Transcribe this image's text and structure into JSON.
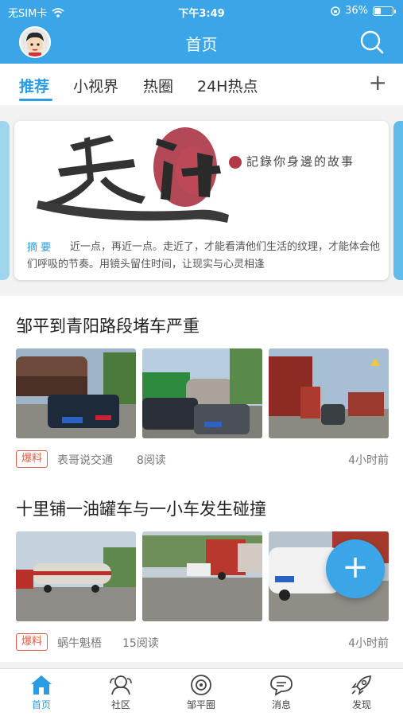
{
  "status_bar": {
    "carrier": "无SIM卡",
    "time": "下午3:49",
    "battery": "36%",
    "battery_level": 0.36
  },
  "header": {
    "title": "首页",
    "avatar_icon": "cartoon-avatar",
    "search_icon": "search-icon"
  },
  "tabs": [
    {
      "label": "推荐",
      "active": true
    },
    {
      "label": "小视界",
      "active": false
    },
    {
      "label": "热圈",
      "active": false
    },
    {
      "label": "24H热点",
      "active": false
    }
  ],
  "add_tab_label": "+",
  "banner": {
    "calligraphy": "走近",
    "slogan": "記錄你身邊的故事",
    "summary_label": "摘 要",
    "summary_text": "近一点，再近一点。走近了，才能看清他们生活的纹理，才能体会他们呼吸的节奏。用镜头留住时间，让现实与心灵相逢"
  },
  "news": [
    {
      "title": "邹平到青阳路段堵车严重",
      "badge": "爆料",
      "author": "表哥说交通",
      "reads": "8阅读",
      "time": "4小时前"
    },
    {
      "title": "十里铺一油罐车与一小车发生碰撞",
      "badge": "爆料",
      "author": "蜗牛魁梧",
      "reads": "15阅读",
      "time": "4小时前"
    }
  ],
  "fab_label": "+",
  "bottom_tabs": [
    {
      "label": "首页",
      "icon": "home-icon",
      "active": true
    },
    {
      "label": "社区",
      "icon": "community-icon",
      "active": false
    },
    {
      "label": "邹平圈",
      "icon": "circle-icon",
      "active": false
    },
    {
      "label": "消息",
      "icon": "message-icon",
      "active": false
    },
    {
      "label": "发现",
      "icon": "rocket-icon",
      "active": false
    }
  ],
  "colors": {
    "brand": "#3aa6e8",
    "active_tab": "#2b9be3",
    "badge": "#e35a4a"
  }
}
